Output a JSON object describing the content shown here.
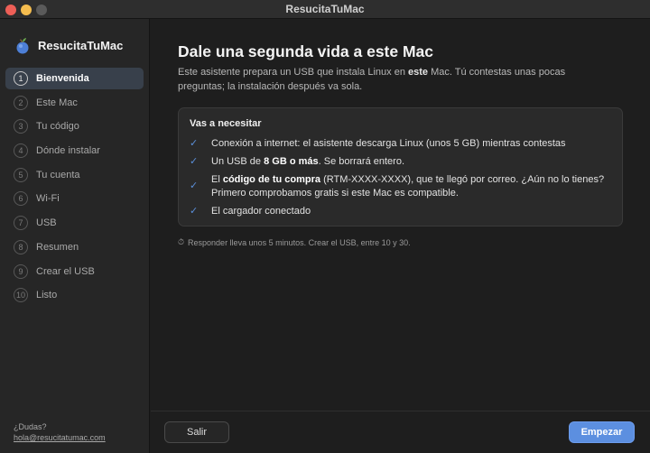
{
  "window": {
    "title": "ResucitaTuMac"
  },
  "sidebar": {
    "brand": "ResucitaTuMac",
    "steps": [
      {
        "num": "1",
        "label": "Bienvenida",
        "active": true
      },
      {
        "num": "2",
        "label": "Este Mac"
      },
      {
        "num": "3",
        "label": "Tu código"
      },
      {
        "num": "4",
        "label": "Dónde instalar"
      },
      {
        "num": "5",
        "label": "Tu cuenta"
      },
      {
        "num": "6",
        "label": "Wi-Fi"
      },
      {
        "num": "7",
        "label": "USB"
      },
      {
        "num": "8",
        "label": "Resumen"
      },
      {
        "num": "9",
        "label": "Crear el USB"
      },
      {
        "num": "10",
        "label": "Listo"
      }
    ],
    "help_question": "¿Dudas?",
    "help_email": "hola@resucitatumac.com"
  },
  "main": {
    "title": "Dale una segunda vida a este Mac",
    "intro_part1": "Este asistente prepara un USB que instala Linux en ",
    "intro_bold": "este",
    "intro_part2": " Mac. Tú contestas unas pocas preguntas; la instalación después va sola.",
    "card": {
      "heading": "Vas a necesitar",
      "check_glyph": "✓",
      "items": [
        {
          "text": "Conexión a internet: el asistente descarga Linux (unos 5 GB) mientras contestas"
        },
        {
          "pre": "Un USB de ",
          "bold": "8 GB o más",
          "post": ". Se borrará entero."
        },
        {
          "pre": "El ",
          "bold": "código de tu compra",
          "post": " (RTM-XXXX-XXXX), que te llegó por correo. ¿Aún no lo tienes? Primero comprobamos gratis si este Mac es compatible."
        },
        {
          "text": "El cargador conectado"
        }
      ]
    },
    "timing_icon": "⏱",
    "timing": "Responder lleva unos 5 minutos. Crear el USB, entre 10 y 30."
  },
  "footer": {
    "quit_label": "Salir",
    "start_label": "Empezar"
  },
  "colors": {
    "accent": "#5c8fe0",
    "check": "#5b8fd9",
    "active_step_bg": "#38404b"
  }
}
